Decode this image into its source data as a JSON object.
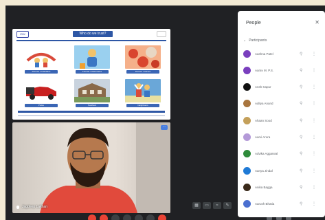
{
  "presentation": {
    "logo": "ISW",
    "title": "Who do we trust?",
    "images": [
      {
        "caption": "Parents / Guardians",
        "icon": "family-icon",
        "colors": [
          "#d94a3a",
          "#f2c26a"
        ]
      },
      {
        "caption": "Friends / Classmates",
        "icon": "kids-icon",
        "colors": [
          "#3a76c4",
          "#9ad0ef"
        ]
      },
      {
        "caption": "Doctors / Nurses",
        "icon": "medical-icon",
        "colors": [
          "#d9452f",
          "#f5b08a"
        ]
      },
      {
        "caption": "Police",
        "icon": "car-icon",
        "colors": [
          "#c82020",
          "#555555"
        ]
      },
      {
        "caption": "Teachers",
        "icon": "school-icon",
        "colors": [
          "#7b8fb2",
          "#c9d3de"
        ]
      },
      {
        "caption": "Neighbours",
        "icon": "people-icon",
        "colors": [
          "#6aa7d8",
          "#e8e0a0"
        ]
      }
    ]
  },
  "camera": {
    "participant_name": "Jagdeep Lakhan",
    "accent": "#4a7fe0"
  },
  "people_panel": {
    "title": "People",
    "close": "✕",
    "section": "Participants",
    "participants": [
      {
        "name": "Aashna Patel",
        "color": "#7a3fbe"
      },
      {
        "name": "Aarav M. P.S.",
        "color": "#7a3fbe"
      },
      {
        "name": "Ansh Kapur",
        "color": "#111111"
      },
      {
        "name": "Aditya Anand",
        "color": "#a8753e"
      },
      {
        "name": "Ahaan Sood",
        "color": "#c4a05a"
      },
      {
        "name": "Aarvi Arora",
        "color": "#b49ad8"
      },
      {
        "name": "Advika Aggarwal",
        "color": "#2e8b3a"
      },
      {
        "name": "Aanya Jindal",
        "color": "#1f7ad6"
      },
      {
        "name": "Anika Bagga",
        "color": "#3a2a1a"
      },
      {
        "name": "Aarush Bhatia",
        "color": "#4a6fd0"
      }
    ]
  },
  "colors": {
    "background": "#202124",
    "panel": "#ffffff",
    "end_call": "#ea4335"
  }
}
